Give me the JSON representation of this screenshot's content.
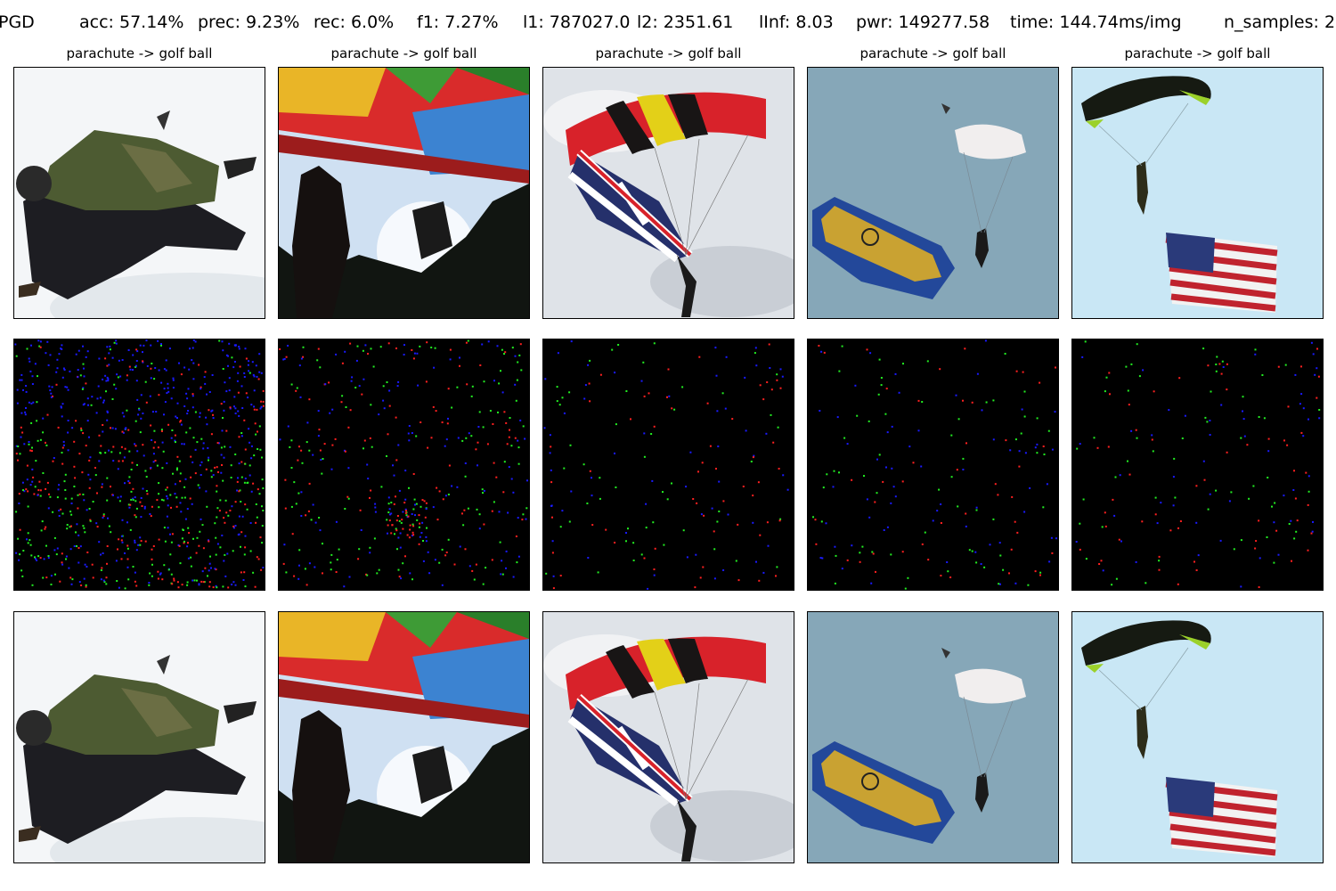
{
  "metrics": {
    "method": "PGD",
    "acc": "acc: 57.14%",
    "prec": "prec: 9.23%",
    "rec": "rec: 6.0%",
    "f1": "f1: 7.27%",
    "l1": "l1: 787027.0",
    "l2": "l2: 2351.61",
    "linf": "lInf: 8.03",
    "pwr": "pwr: 149277.58",
    "time": "time: 144.74ms/img",
    "n_samples": "n_samples: 2"
  },
  "columns": [
    {
      "title": "parachute -> golf ball",
      "scene": "skydiver"
    },
    {
      "title": "parachute -> golf ball",
      "scene": "rainbow-parachute"
    },
    {
      "title": "parachute -> golf ball",
      "scene": "union-jack-canopy"
    },
    {
      "title": "parachute -> golf ball",
      "scene": "flag-jumper"
    },
    {
      "title": "parachute -> golf ball",
      "scene": "us-flag-jumper"
    }
  ],
  "rows": [
    "original",
    "perturbation",
    "adversarial"
  ],
  "colors": {
    "noise_blue": "#1a1aff",
    "noise_green": "#22ee22",
    "noise_red": "#ff2020",
    "sky_light": "#c9e7f5",
    "sky_gray": "#86a7b8"
  }
}
